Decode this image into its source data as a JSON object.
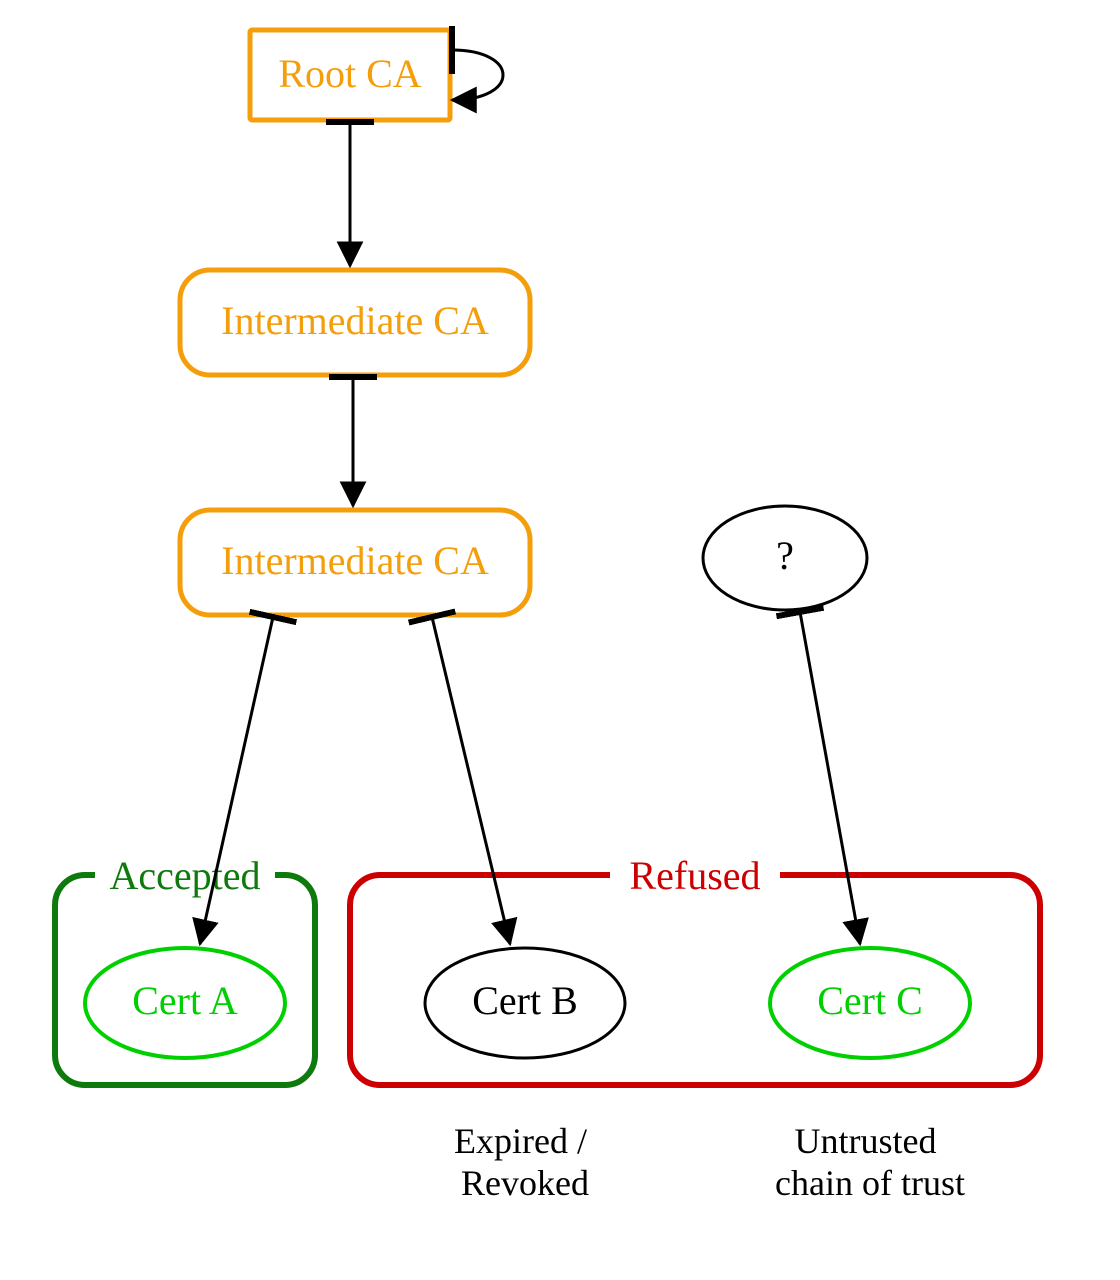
{
  "colors": {
    "orange": "#f59e0b",
    "green": "#0e7a0d",
    "brightgreen": "#00d000",
    "red": "#cc0000",
    "black": "#000000"
  },
  "nodes": {
    "root": {
      "label": "Root CA",
      "text_color": "#f59e0b"
    },
    "int1": {
      "label": "Intermediate CA",
      "text_color": "#f59e0b"
    },
    "int2": {
      "label": "Intermediate CA",
      "text_color": "#f59e0b"
    },
    "unknown": {
      "label": "?",
      "text_color": "#000000"
    },
    "certA": {
      "label": "Cert A",
      "text_color": "#00d000"
    },
    "certB": {
      "label": "Cert B",
      "text_color": "#000000"
    },
    "certC": {
      "label": "Cert C",
      "text_color": "#00d000"
    }
  },
  "groups": {
    "accepted": {
      "title": "Accepted",
      "color": "#0e7a0d"
    },
    "refused": {
      "title": "Refused",
      "color": "#cc0000"
    }
  },
  "captions": {
    "certB": "Expired /\nRevoked",
    "certC": "Untrusted\nchain of trust"
  }
}
